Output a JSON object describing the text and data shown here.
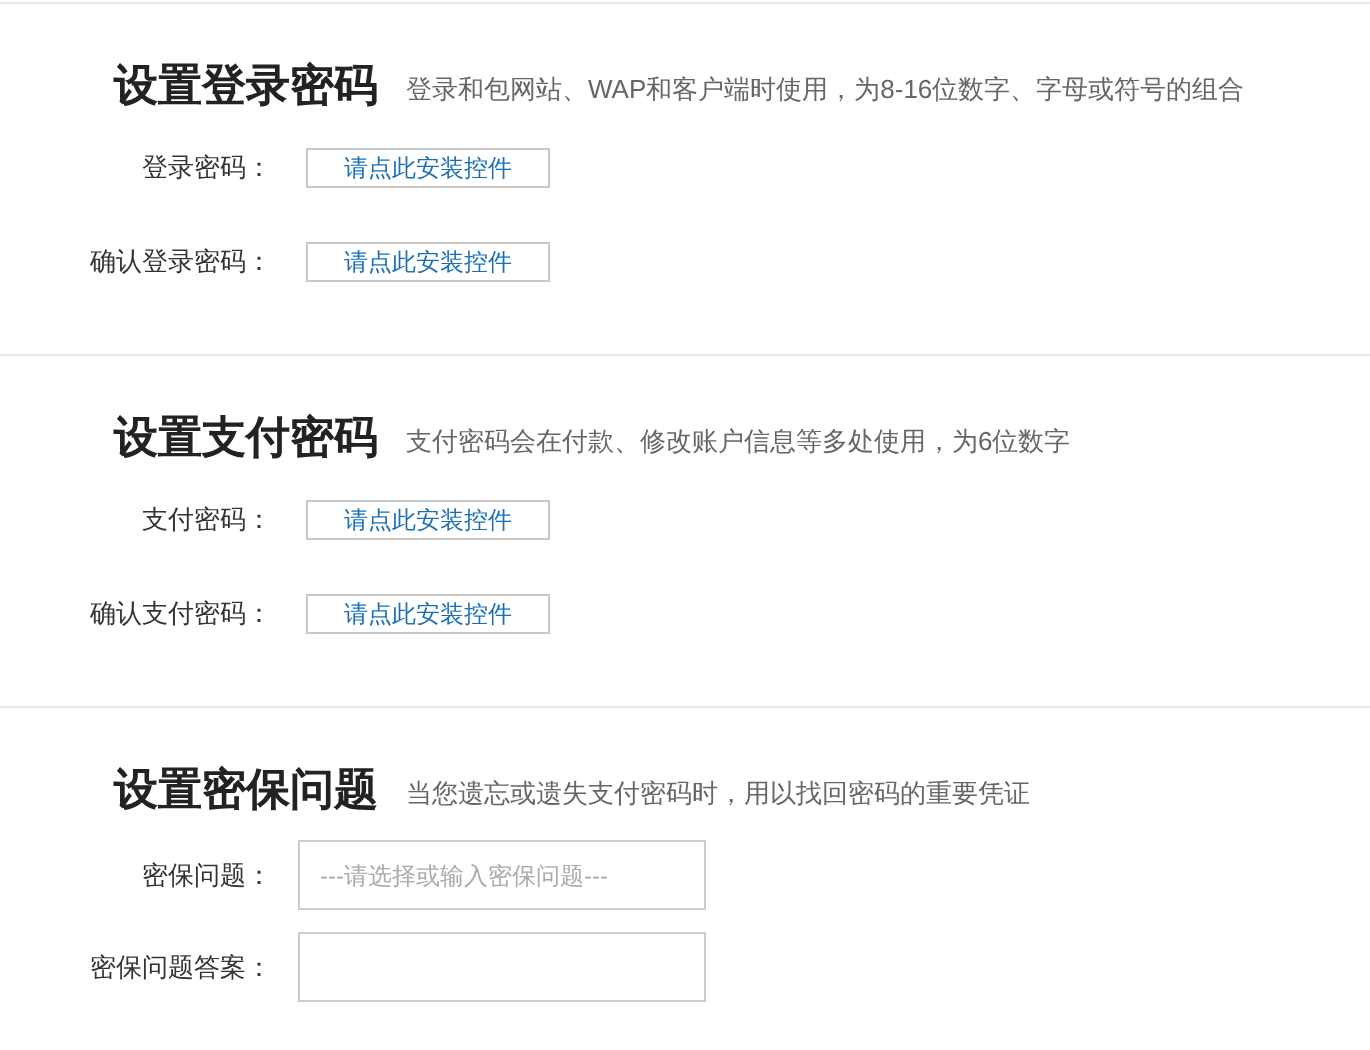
{
  "sections": [
    {
      "title": "设置登录密码",
      "description": "登录和包网站、WAP和客户端时使用，为8-16位数字、字母或符号的组合",
      "fields": [
        {
          "kind": "button",
          "label": "登录密码：",
          "text": "请点此安装控件"
        },
        {
          "kind": "button",
          "label": "确认登录密码：",
          "text": "请点此安装控件"
        }
      ]
    },
    {
      "title": "设置支付密码",
      "description": "支付密码会在付款、修改账户信息等多处使用，为6位数字",
      "fields": [
        {
          "kind": "button",
          "label": "支付密码：",
          "text": "请点此安装控件"
        },
        {
          "kind": "button",
          "label": "确认支付密码：",
          "text": "请点此安装控件"
        }
      ]
    },
    {
      "title": "设置密保问题",
      "description": "当您遗忘或遗失支付密码时，用以找回密码的重要凭证",
      "fields": [
        {
          "kind": "input",
          "label": "密保问题：",
          "placeholder": "---请选择或输入密保问题---"
        },
        {
          "kind": "input",
          "label": "密保问题答案："
        }
      ]
    }
  ]
}
